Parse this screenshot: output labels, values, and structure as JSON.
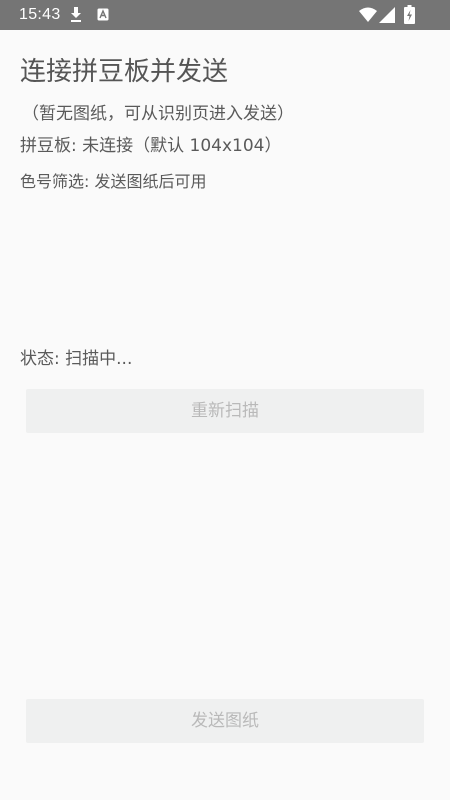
{
  "status_bar": {
    "time": "15:43",
    "icons": [
      "download-icon",
      "a-notification-icon",
      "wifi-icon",
      "signal-icon",
      "battery-charging-icon"
    ]
  },
  "page": {
    "title": "连接拼豆板并发送",
    "hint": "（暂无图纸，可从识别页进入发送）",
    "board_status": "拼豆板: 未连接（默认 104x104）",
    "color_filter": "色号筛选: 发送图纸后可用",
    "scan_status": "状态: 扫描中..."
  },
  "buttons": {
    "rescan_label": "重新扫描",
    "send_label": "发送图纸"
  },
  "colors": {
    "status_bar_bg": "#757575",
    "background": "#fafafa",
    "button_bg": "#eff0f0",
    "button_text_disabled": "#b9b9b9",
    "text": "#5a5a5a"
  }
}
